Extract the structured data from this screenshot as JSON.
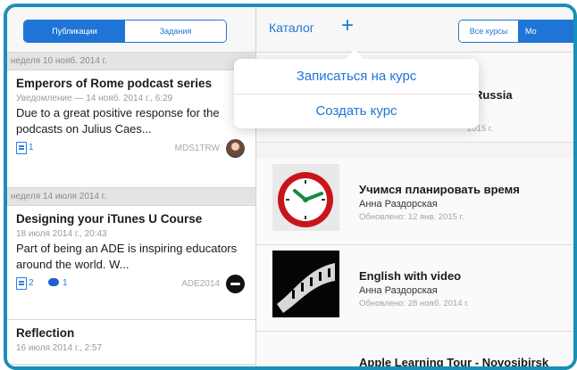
{
  "left": {
    "tabs": [
      "Публикации",
      "Задания"
    ],
    "groups": [
      {
        "week": "неделя 10 нояб. 2014 г."
      },
      {
        "week": "неделя 14 июля 2014 г."
      }
    ],
    "items": [
      {
        "title": "Emperors of Rome podcast series",
        "meta": "Уведомление — 14 нояб. 2014 г., 6:29",
        "body": "Due to a great positive response for the podcasts on Julius Caes...",
        "count": "1",
        "code": "MDS1TRW"
      },
      {
        "title": "Designing your iTunes U Course",
        "meta": "18 июля 2014 г., 20:43",
        "body": "Part of being an ADE is inspiring educators around the world.  W...",
        "count": "2",
        "chat_count": "1",
        "code": "ADE2014"
      },
      {
        "title": "Reflection",
        "meta": "16 июля 2014 г., 2:57"
      }
    ]
  },
  "right": {
    "catalog_label": "Каталог",
    "plus_label": "+",
    "segment": [
      "Все курсы",
      "Мо"
    ],
    "courses": [
      {
        "title": "- Russia",
        "updated": "2015 г."
      },
      {
        "title": "Учимся планировать время",
        "author": "Анна Раздорская",
        "updated": "Обновлено: 12 янв. 2015 г."
      },
      {
        "title": "English with video",
        "author": "Анна Раздорская",
        "updated": "Обновлено: 28 нояб. 2014 г."
      },
      {
        "title": "Apple Learning Tour - Novosibirsk"
      }
    ]
  },
  "popover": {
    "enroll": "Записаться на курс",
    "create": "Создать курс"
  },
  "colors": {
    "accent": "#1f75d6",
    "frame": "#1a8fb8"
  }
}
